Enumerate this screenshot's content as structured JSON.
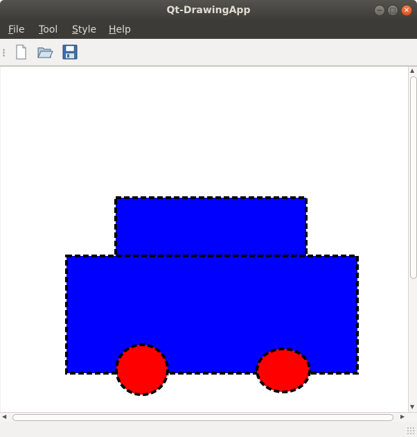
{
  "window": {
    "title": "Qt-DrawingApp"
  },
  "menu": [
    {
      "label": "File",
      "underline": "F",
      "rest": "ile"
    },
    {
      "label": "Tool",
      "underline": "T",
      "rest": "ool"
    },
    {
      "label": "Style",
      "underline": "S",
      "rest": "tyle"
    },
    {
      "label": "Help",
      "underline": "H",
      "rest": "elp"
    }
  ],
  "toolbar": {
    "buttons": [
      {
        "name": "new-file",
        "icon": "new-document-icon"
      },
      {
        "name": "open-file",
        "icon": "open-folder-icon"
      },
      {
        "name": "save-file",
        "icon": "save-disk-icon"
      }
    ]
  },
  "canvas": {
    "label": "Qt-DrawingApp",
    "shape_fill": "#0000ff",
    "wheel_fill": "#ff0000",
    "outline": "#000000",
    "outline_style": "dashed"
  }
}
